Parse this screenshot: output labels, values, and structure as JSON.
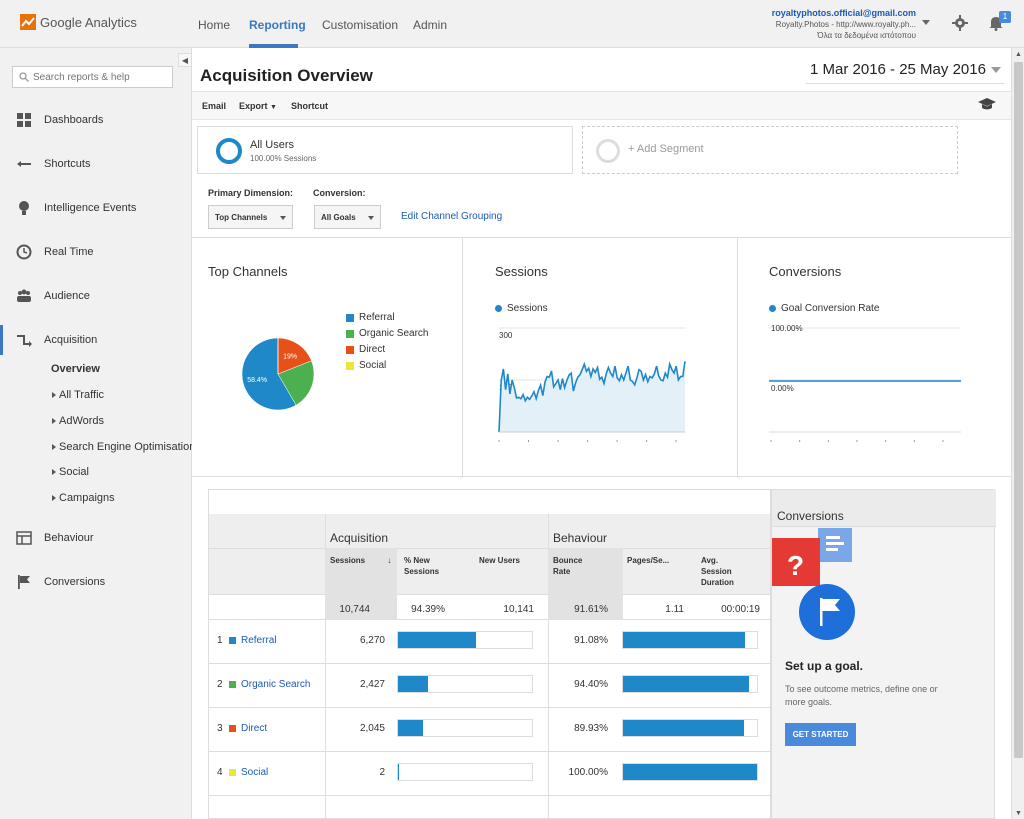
{
  "app": {
    "name": "Google Analytics"
  },
  "nav": {
    "home": "Home",
    "reporting": "Reporting",
    "customisation": "Customisation",
    "admin": "Admin"
  },
  "account": {
    "email": "royaltyphotos.official@gmail.com",
    "property": "Royalty.Photos - http://www.royalty.ph...",
    "view": "Όλα τα δεδομένα ιστότοπου"
  },
  "notifications": {
    "count": "1"
  },
  "sidebar": {
    "search_placeholder": "Search reports & help",
    "items": [
      {
        "label": "Dashboards",
        "icon": "grid-icon"
      },
      {
        "label": "Shortcuts",
        "icon": "shortcut-arrow-icon"
      },
      {
        "label": "Intelligence Events",
        "icon": "lightbulb-icon"
      },
      {
        "label": "Real Time",
        "icon": "clock-icon"
      },
      {
        "label": "Audience",
        "icon": "people-icon"
      },
      {
        "label": "Acquisition",
        "icon": "acquisition-icon"
      },
      {
        "label": "Behaviour",
        "icon": "behaviour-icon"
      },
      {
        "label": "Conversions",
        "icon": "flag-icon"
      }
    ],
    "sub": [
      "Overview",
      "All Traffic",
      "AdWords",
      "Search Engine Optimisation",
      "Social",
      "Campaigns"
    ]
  },
  "page": {
    "title": "Acquisition Overview",
    "date_range": "1 Mar 2016 - 25 May 2016",
    "actions": {
      "email": "Email",
      "export": "Export",
      "shortcut": "Shortcut"
    }
  },
  "segments": {
    "all_users": "All Users",
    "all_users_sub": "100.00% Sessions",
    "add": "+ Add Segment"
  },
  "dimensions": {
    "primary_label": "Primary Dimension:",
    "primary_value": "Top Channels",
    "conversion_label": "Conversion:",
    "conversion_value": "All Goals",
    "edit_grouping": "Edit Channel Grouping"
  },
  "colors": {
    "referral": "#1e88c8",
    "organic": "#4caf50",
    "direct": "#e8501a",
    "social": "#e8e83a",
    "accent": "#3b78c1"
  },
  "chart_data": [
    {
      "type": "pie",
      "title": "Top Channels",
      "categories": [
        "Referral",
        "Organic Search",
        "Direct",
        "Social"
      ],
      "values": [
        58.4,
        22.6,
        19.0,
        0.02
      ],
      "slice_labels": [
        "58.4%",
        "",
        "19%",
        ""
      ]
    },
    {
      "type": "area",
      "title": "Sessions",
      "series": [
        {
          "name": "Sessions",
          "values": [
            0,
            148,
            182,
            122,
            168,
            110,
            150,
            128,
            98,
            100,
            96,
            108,
            90,
            100,
            94,
            104,
            116,
            96,
            120,
            135,
            105,
            144,
            160,
            158,
            176,
            130,
            140,
            150,
            122,
            154,
            128,
            148,
            164,
            170,
            118,
            142,
            158,
            165,
            180,
            196,
            175,
            184,
            160,
            182,
            172,
            186,
            152,
            158,
            140,
            168,
            186,
            170,
            160,
            190,
            156,
            148,
            165,
            150,
            170,
            190,
            150,
            146,
            136,
            156,
            180,
            175,
            150,
            166,
            145,
            160,
            156,
            168,
            190,
            162,
            150,
            148,
            170,
            158,
            196,
            180,
            170,
            190,
            150,
            160,
            160,
            204
          ]
        }
      ],
      "yticks": [
        "300",
        "150"
      ],
      "ylim": [
        0,
        300
      ]
    },
    {
      "type": "line",
      "title": "Conversions",
      "series": [
        {
          "name": "Goal Conversion Rate",
          "values": [
            0,
            0,
            0,
            0,
            0,
            0,
            0,
            0,
            0,
            0
          ]
        }
      ],
      "yticks": [
        "100.00%",
        "0.00%"
      ],
      "ylim": [
        0,
        100
      ]
    }
  ],
  "table": {
    "group_acquisition": "Acquisition",
    "group_behaviour": "Behaviour",
    "headers": {
      "sessions": "Sessions",
      "new_sessions_1": "% New",
      "new_sessions_2": "Sessions",
      "new_users": "New Users",
      "bounce_1": "Bounce",
      "bounce_2": "Rate",
      "pages": "Pages/Se...",
      "dur_1": "Avg.",
      "dur_2": "Session",
      "dur_3": "Duration"
    },
    "totals": {
      "sessions": "10,744",
      "new_sessions": "94.39%",
      "new_users": "10,141",
      "bounce": "91.61%",
      "pages": "1.11",
      "duration": "00:00:19"
    },
    "rows": [
      {
        "num": "1",
        "channel": "Referral",
        "sessions": "6,270",
        "bounce": "91.08%",
        "sessions_share": 0.584,
        "bounce_rate": 0.9108
      },
      {
        "num": "2",
        "channel": "Organic Search",
        "sessions": "2,427",
        "bounce": "94.40%",
        "sessions_share": 0.226,
        "bounce_rate": 0.944
      },
      {
        "num": "3",
        "channel": "Direct",
        "sessions": "2,045",
        "bounce": "89.93%",
        "sessions_share": 0.19,
        "bounce_rate": 0.8993
      },
      {
        "num": "4",
        "channel": "Social",
        "sessions": "2",
        "bounce": "100.00%",
        "sessions_share": 0.0002,
        "bounce_rate": 1.0
      }
    ]
  },
  "goal": {
    "title": "Conversions",
    "setup": "Set up a goal.",
    "desc": "To see outcome metrics, define one or more goals.",
    "button": "GET STARTED"
  }
}
